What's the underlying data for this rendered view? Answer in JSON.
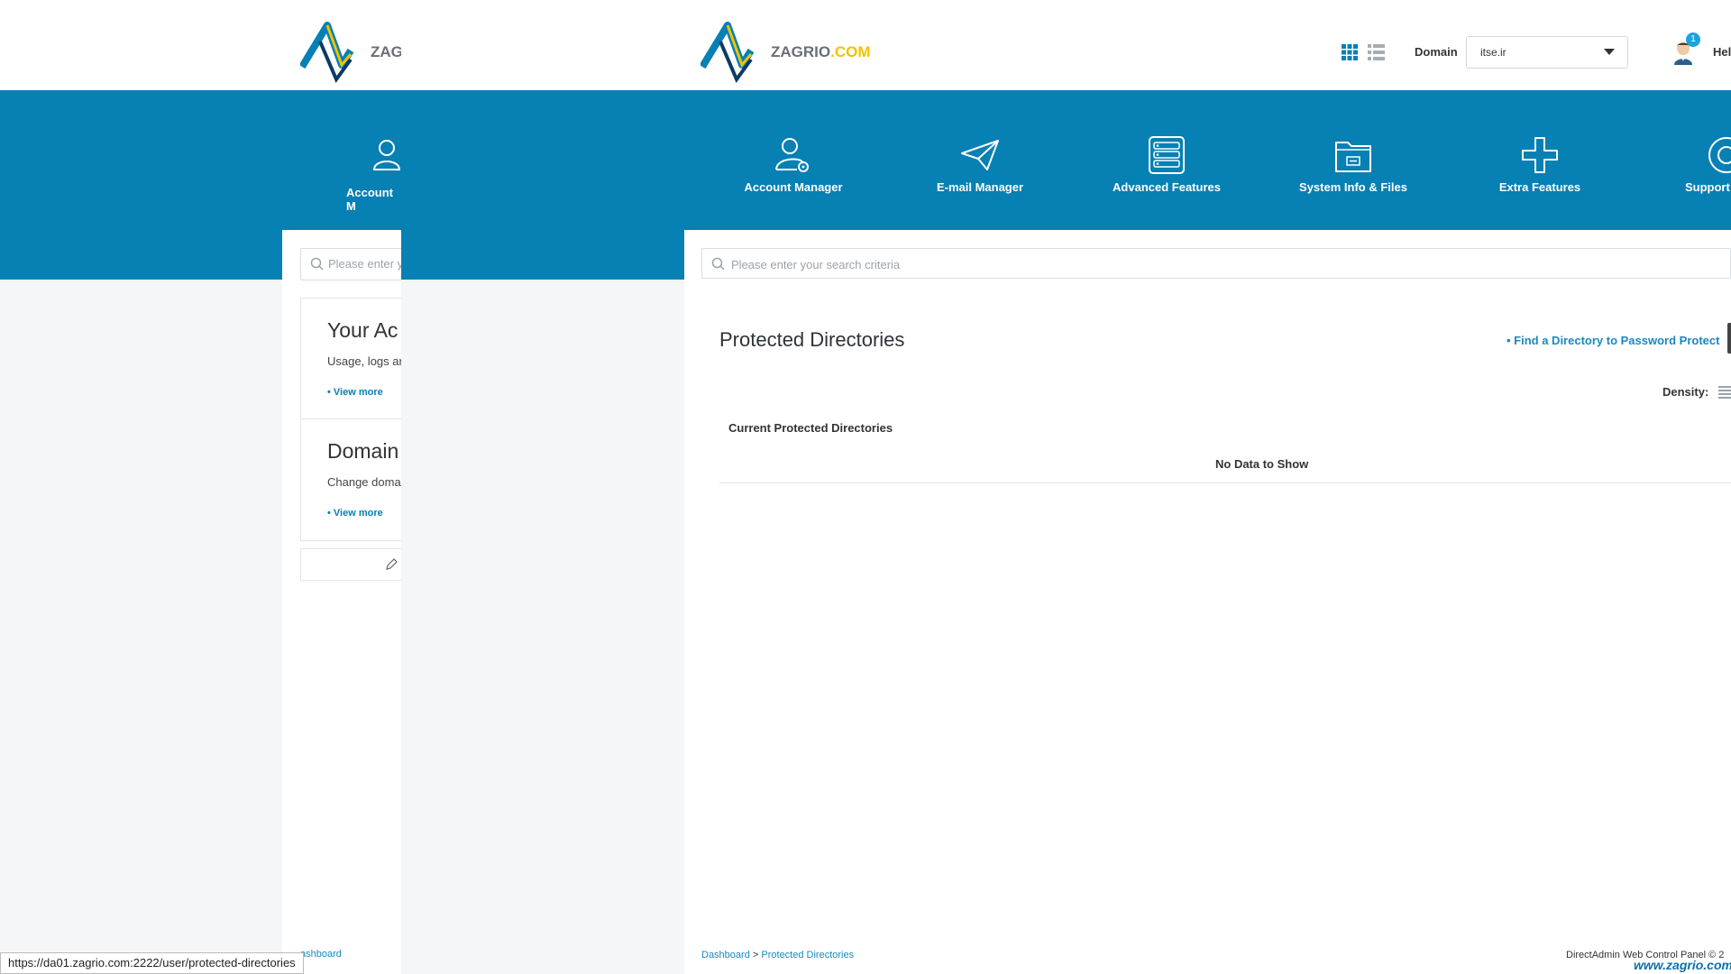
{
  "header": {
    "logo_text": "ZAGRIO",
    "logo_suffix": ".COM",
    "ghost_logo_text": "ZAG",
    "domain_label": "Domain",
    "domain_value": "itse.ir",
    "notification_count": "1",
    "help_label": "Hel"
  },
  "nav": {
    "items": [
      {
        "label": "Account Manager",
        "icon": "account-manager-icon"
      },
      {
        "label": "E-mail Manager",
        "icon": "paper-plane-icon"
      },
      {
        "label": "Advanced Features",
        "icon": "server-icon"
      },
      {
        "label": "System Info & Files",
        "icon": "folder-icon"
      },
      {
        "label": "Extra Features",
        "icon": "plus-icon"
      },
      {
        "label": "Support",
        "icon": "lifebuoy-icon"
      }
    ],
    "ghost_label": "Account M"
  },
  "search": {
    "placeholder": "Please enter your search criteria",
    "ghost_placeholder": "Please enter y"
  },
  "ghost": {
    "card1_title": "Your Ac",
    "card1_desc": "Usage, logs ar",
    "card2_title": "Domain",
    "card2_desc": "Change doma",
    "view_more": "• View more",
    "breadcrumb": "ashboard"
  },
  "main": {
    "title": "Protected Directories",
    "find_link": "• Find a Directory to Password Protect",
    "density_label": "Density:",
    "section_title": "Current Protected Directories",
    "empty_text": "No Data to Show"
  },
  "footer": {
    "breadcrumb_home": "Dashboard",
    "breadcrumb_sep": ">",
    "breadcrumb_current": "Protected Directories",
    "copyright": "DirectAdmin Web Control Panel © 2",
    "watermark": "www.zagrio.com"
  },
  "status": {
    "url": "https://da01.zagrio.com:2222/user/protected-directories"
  },
  "colors": {
    "brand_blue": "#0780b4",
    "link_blue": "#1a88c0",
    "logo_yellow": "#f2c200"
  }
}
